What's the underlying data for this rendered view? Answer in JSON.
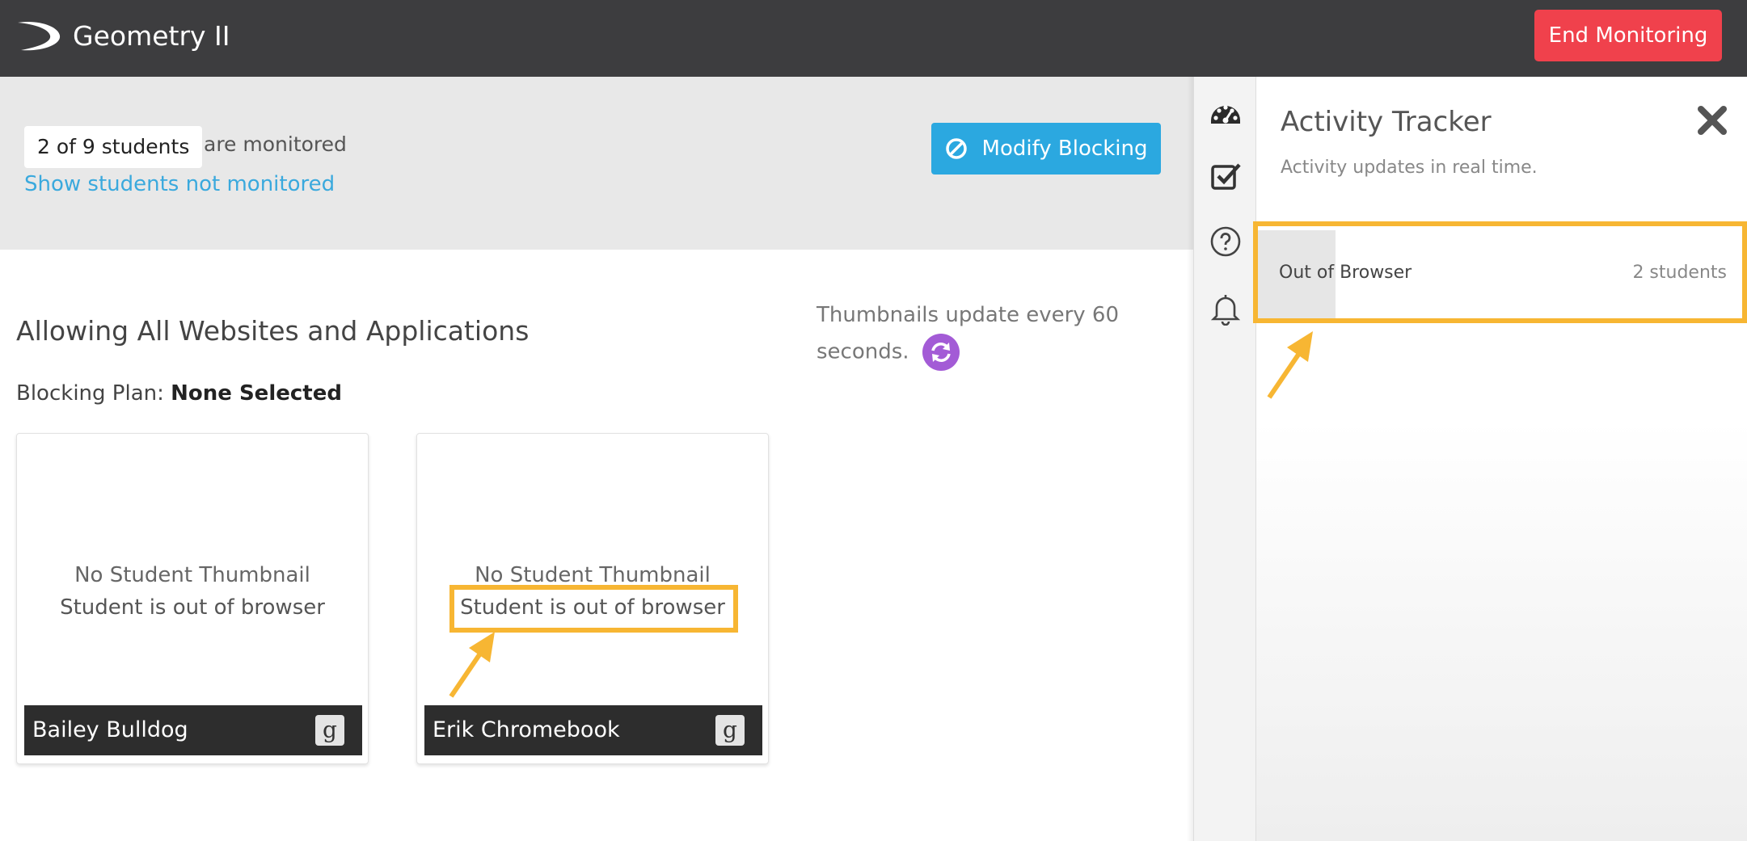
{
  "header": {
    "app_title": "Geometry II",
    "end_button_label": "End Monitoring"
  },
  "monitor": {
    "count_label": "2 of 9 students",
    "monitored_suffix": "are monitored",
    "show_link": "Show students not monitored",
    "modify_button_label": "Modify Blocking"
  },
  "main": {
    "heading": "Allowing All Websites and Applications",
    "plan_prefix": "Blocking Plan:",
    "plan_value": "None Selected",
    "thumbnail_note": "Thumbnails update every 60 seconds."
  },
  "students": [
    {
      "name": "Bailey Bulldog",
      "line1": "No Student Thumbnail",
      "line2": "Student is out of browser",
      "badge": "g"
    },
    {
      "name": "Erik Chromebook",
      "line1": "No Student Thumbnail",
      "line2": "Student is out of browser",
      "badge": "g"
    }
  ],
  "panel": {
    "title": "Activity Tracker",
    "subtitle": "Activity updates in real time.",
    "rows": [
      {
        "label": "Out of Browser",
        "count": "2 students",
        "fill_fraction": 0.16
      }
    ]
  },
  "icons": [
    "logo-swoosh-icon",
    "block-icon",
    "refresh-icon",
    "dashboard-icon",
    "checkbox-icon",
    "help-icon",
    "bell-icon",
    "close-icon",
    "arrow-icon"
  ],
  "colors": {
    "topbar": "#3d3d3f",
    "danger": "#f0414c",
    "primary": "#2ba8e0",
    "link": "#3aa9dd",
    "highlight": "#f7b633",
    "refresh": "#a35bd6"
  }
}
